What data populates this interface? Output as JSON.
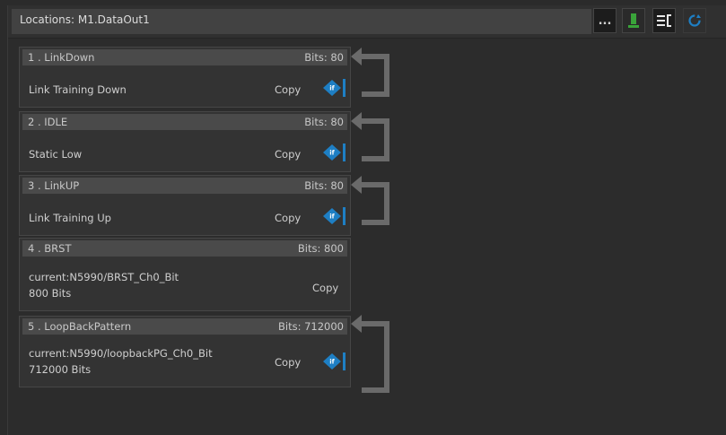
{
  "header": {
    "title": "Locations: M1.DataOut1",
    "more_label": "...",
    "icons": [
      "download-icon",
      "list-icon",
      "refresh-icon"
    ]
  },
  "colors": {
    "accent_blue": "#1e7fc4",
    "download_green": "#3aa43a",
    "loop_gray": "#6a6a6a"
  },
  "blocks": [
    {
      "index_name": "1 . LinkDown",
      "bits": "Bits: 80",
      "line1": "Link Training  Down",
      "line2": "",
      "copy": "Copy",
      "has_if": true,
      "has_loop": true
    },
    {
      "index_name": "2 . IDLE",
      "bits": "Bits: 80",
      "line1": "Static  Low",
      "line2": "",
      "copy": "Copy",
      "has_if": true,
      "has_loop": true
    },
    {
      "index_name": "3 . LinkUP",
      "bits": "Bits: 80",
      "line1": "Link Training  Up",
      "line2": "",
      "copy": "Copy",
      "has_if": true,
      "has_loop": true
    },
    {
      "index_name": "4 . BRST",
      "bits": "Bits: 800",
      "line1": "current:N5990/BRST_Ch0_Bit",
      "line2": "800 Bits",
      "copy": "Copy",
      "has_if": false,
      "has_loop": false
    },
    {
      "index_name": "5 . LoopBackPattern",
      "bits": "Bits: 712000",
      "line1": "current:N5990/loopbackPG_Ch0_Bit",
      "line2": "712000 Bits",
      "copy": "Copy",
      "has_if": true,
      "has_loop": true
    }
  ]
}
